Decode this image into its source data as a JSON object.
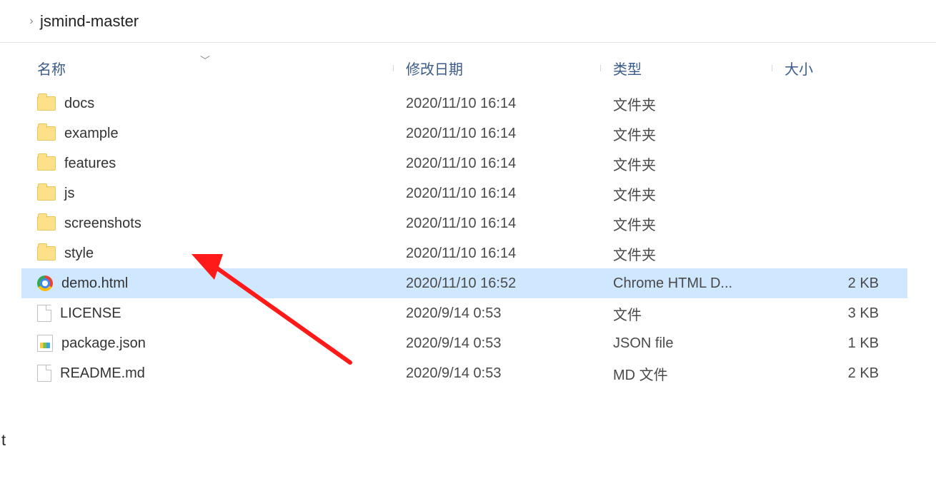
{
  "breadcrumb": {
    "folder": "jsmind-master"
  },
  "columns": {
    "name": "名称",
    "date": "修改日期",
    "type": "类型",
    "size": "大小"
  },
  "sort": {
    "column": "name",
    "indicator": "﹀"
  },
  "rows": [
    {
      "icon": "folder",
      "name": "docs",
      "date": "2020/11/10 16:14",
      "type": "文件夹",
      "size": "",
      "selected": false
    },
    {
      "icon": "folder",
      "name": "example",
      "date": "2020/11/10 16:14",
      "type": "文件夹",
      "size": "",
      "selected": false
    },
    {
      "icon": "folder",
      "name": "features",
      "date": "2020/11/10 16:14",
      "type": "文件夹",
      "size": "",
      "selected": false
    },
    {
      "icon": "folder",
      "name": "js",
      "date": "2020/11/10 16:14",
      "type": "文件夹",
      "size": "",
      "selected": false
    },
    {
      "icon": "folder",
      "name": "screenshots",
      "date": "2020/11/10 16:14",
      "type": "文件夹",
      "size": "",
      "selected": false
    },
    {
      "icon": "folder",
      "name": "style",
      "date": "2020/11/10 16:14",
      "type": "文件夹",
      "size": "",
      "selected": false
    },
    {
      "icon": "chrome",
      "name": "demo.html",
      "date": "2020/11/10 16:52",
      "type": "Chrome HTML D...",
      "size": "2 KB",
      "selected": true
    },
    {
      "icon": "file",
      "name": "LICENSE",
      "date": "2020/9/14 0:53",
      "type": "文件",
      "size": "3 KB",
      "selected": false
    },
    {
      "icon": "json",
      "name": "package.json",
      "date": "2020/9/14 0:53",
      "type": "JSON file",
      "size": "1 KB",
      "selected": false
    },
    {
      "icon": "file",
      "name": "README.md",
      "date": "2020/9/14 0:53",
      "type": "MD 文件",
      "size": "2 KB",
      "selected": false
    }
  ],
  "stray": "t"
}
